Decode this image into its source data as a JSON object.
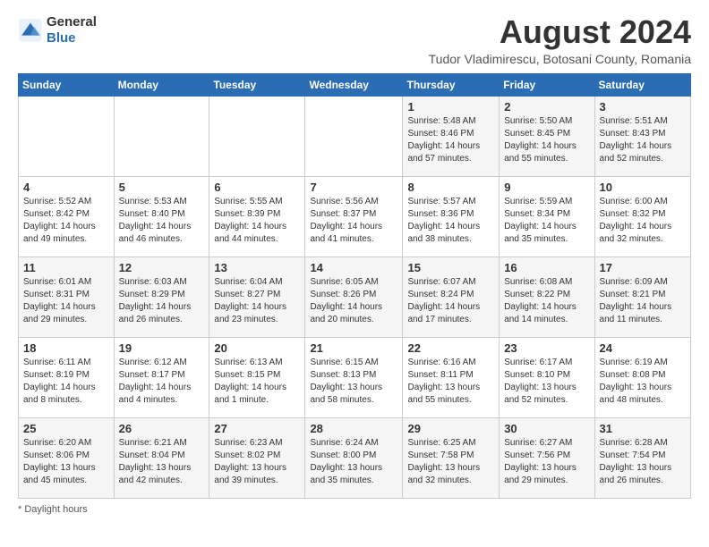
{
  "logo": {
    "text_general": "General",
    "text_blue": "Blue"
  },
  "title": {
    "month_year": "August 2024",
    "location": "Tudor Vladimirescu, Botosani County, Romania"
  },
  "days_of_week": [
    "Sunday",
    "Monday",
    "Tuesday",
    "Wednesday",
    "Thursday",
    "Friday",
    "Saturday"
  ],
  "footer": {
    "label": "Daylight hours"
  },
  "weeks": [
    [
      {
        "day": "",
        "info": ""
      },
      {
        "day": "",
        "info": ""
      },
      {
        "day": "",
        "info": ""
      },
      {
        "day": "",
        "info": ""
      },
      {
        "day": "1",
        "info": "Sunrise: 5:48 AM\nSunset: 8:46 PM\nDaylight: 14 hours\nand 57 minutes."
      },
      {
        "day": "2",
        "info": "Sunrise: 5:50 AM\nSunset: 8:45 PM\nDaylight: 14 hours\nand 55 minutes."
      },
      {
        "day": "3",
        "info": "Sunrise: 5:51 AM\nSunset: 8:43 PM\nDaylight: 14 hours\nand 52 minutes."
      }
    ],
    [
      {
        "day": "4",
        "info": "Sunrise: 5:52 AM\nSunset: 8:42 PM\nDaylight: 14 hours\nand 49 minutes."
      },
      {
        "day": "5",
        "info": "Sunrise: 5:53 AM\nSunset: 8:40 PM\nDaylight: 14 hours\nand 46 minutes."
      },
      {
        "day": "6",
        "info": "Sunrise: 5:55 AM\nSunset: 8:39 PM\nDaylight: 14 hours\nand 44 minutes."
      },
      {
        "day": "7",
        "info": "Sunrise: 5:56 AM\nSunset: 8:37 PM\nDaylight: 14 hours\nand 41 minutes."
      },
      {
        "day": "8",
        "info": "Sunrise: 5:57 AM\nSunset: 8:36 PM\nDaylight: 14 hours\nand 38 minutes."
      },
      {
        "day": "9",
        "info": "Sunrise: 5:59 AM\nSunset: 8:34 PM\nDaylight: 14 hours\nand 35 minutes."
      },
      {
        "day": "10",
        "info": "Sunrise: 6:00 AM\nSunset: 8:32 PM\nDaylight: 14 hours\nand 32 minutes."
      }
    ],
    [
      {
        "day": "11",
        "info": "Sunrise: 6:01 AM\nSunset: 8:31 PM\nDaylight: 14 hours\nand 29 minutes."
      },
      {
        "day": "12",
        "info": "Sunrise: 6:03 AM\nSunset: 8:29 PM\nDaylight: 14 hours\nand 26 minutes."
      },
      {
        "day": "13",
        "info": "Sunrise: 6:04 AM\nSunset: 8:27 PM\nDaylight: 14 hours\nand 23 minutes."
      },
      {
        "day": "14",
        "info": "Sunrise: 6:05 AM\nSunset: 8:26 PM\nDaylight: 14 hours\nand 20 minutes."
      },
      {
        "day": "15",
        "info": "Sunrise: 6:07 AM\nSunset: 8:24 PM\nDaylight: 14 hours\nand 17 minutes."
      },
      {
        "day": "16",
        "info": "Sunrise: 6:08 AM\nSunset: 8:22 PM\nDaylight: 14 hours\nand 14 minutes."
      },
      {
        "day": "17",
        "info": "Sunrise: 6:09 AM\nSunset: 8:21 PM\nDaylight: 14 hours\nand 11 minutes."
      }
    ],
    [
      {
        "day": "18",
        "info": "Sunrise: 6:11 AM\nSunset: 8:19 PM\nDaylight: 14 hours\nand 8 minutes."
      },
      {
        "day": "19",
        "info": "Sunrise: 6:12 AM\nSunset: 8:17 PM\nDaylight: 14 hours\nand 4 minutes."
      },
      {
        "day": "20",
        "info": "Sunrise: 6:13 AM\nSunset: 8:15 PM\nDaylight: 14 hours\nand 1 minute."
      },
      {
        "day": "21",
        "info": "Sunrise: 6:15 AM\nSunset: 8:13 PM\nDaylight: 13 hours\nand 58 minutes."
      },
      {
        "day": "22",
        "info": "Sunrise: 6:16 AM\nSunset: 8:11 PM\nDaylight: 13 hours\nand 55 minutes."
      },
      {
        "day": "23",
        "info": "Sunrise: 6:17 AM\nSunset: 8:10 PM\nDaylight: 13 hours\nand 52 minutes."
      },
      {
        "day": "24",
        "info": "Sunrise: 6:19 AM\nSunset: 8:08 PM\nDaylight: 13 hours\nand 48 minutes."
      }
    ],
    [
      {
        "day": "25",
        "info": "Sunrise: 6:20 AM\nSunset: 8:06 PM\nDaylight: 13 hours\nand 45 minutes."
      },
      {
        "day": "26",
        "info": "Sunrise: 6:21 AM\nSunset: 8:04 PM\nDaylight: 13 hours\nand 42 minutes."
      },
      {
        "day": "27",
        "info": "Sunrise: 6:23 AM\nSunset: 8:02 PM\nDaylight: 13 hours\nand 39 minutes."
      },
      {
        "day": "28",
        "info": "Sunrise: 6:24 AM\nSunset: 8:00 PM\nDaylight: 13 hours\nand 35 minutes."
      },
      {
        "day": "29",
        "info": "Sunrise: 6:25 AM\nSunset: 7:58 PM\nDaylight: 13 hours\nand 32 minutes."
      },
      {
        "day": "30",
        "info": "Sunrise: 6:27 AM\nSunset: 7:56 PM\nDaylight: 13 hours\nand 29 minutes."
      },
      {
        "day": "31",
        "info": "Sunrise: 6:28 AM\nSunset: 7:54 PM\nDaylight: 13 hours\nand 26 minutes."
      }
    ]
  ]
}
